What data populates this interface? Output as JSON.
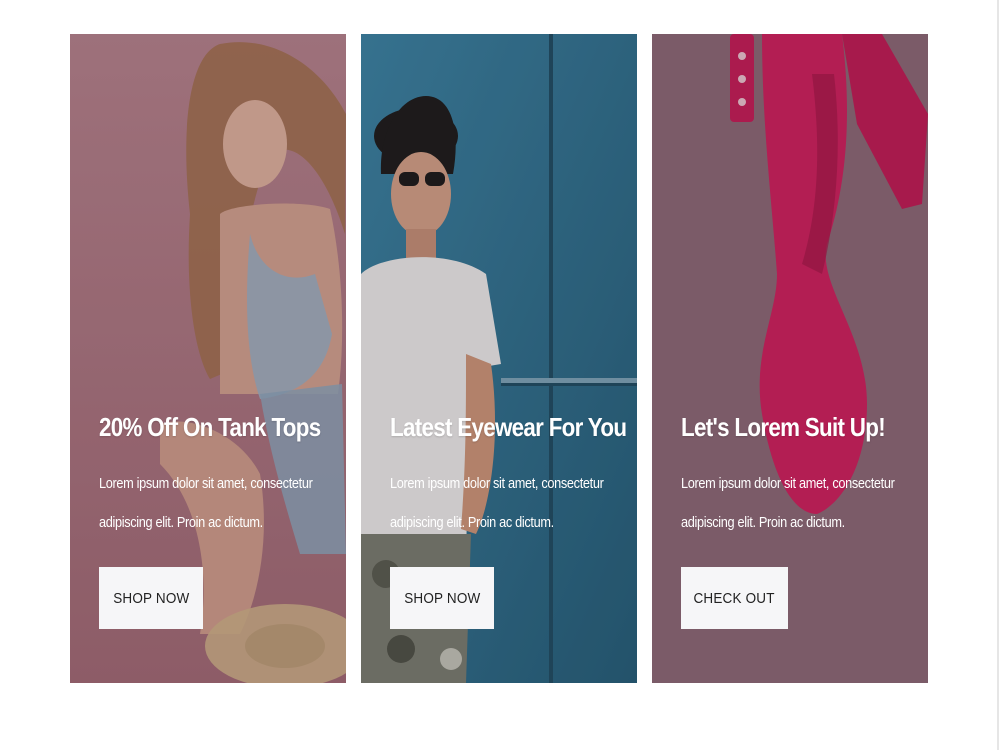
{
  "promo_cards": [
    {
      "title": "20% Off On Tank Tops",
      "description": "Lorem ipsum dolor sit amet, consectetur adipiscing elit. Proin ac dictum.",
      "button_label": "SHOP NOW",
      "image": "woman-in-tank-top-photo",
      "background_color": "#a9737f"
    },
    {
      "title": "Latest Eyewear For You",
      "description": "Lorem ipsum dolor sit amet, consectetur adipiscing elit. Proin ac dictum.",
      "button_label": "SHOP NOW",
      "image": "man-in-sunglasses-photo",
      "background_color": "#2f6f8c"
    },
    {
      "title": "Let's Lorem Suit Up!",
      "description": "Lorem ipsum dolor sit amet, consectetur adipiscing elit. Proin ac dictum.",
      "button_label": "CHECK OUT",
      "image": "pink-boot-photo",
      "background_color": "#7d5f6b"
    }
  ]
}
